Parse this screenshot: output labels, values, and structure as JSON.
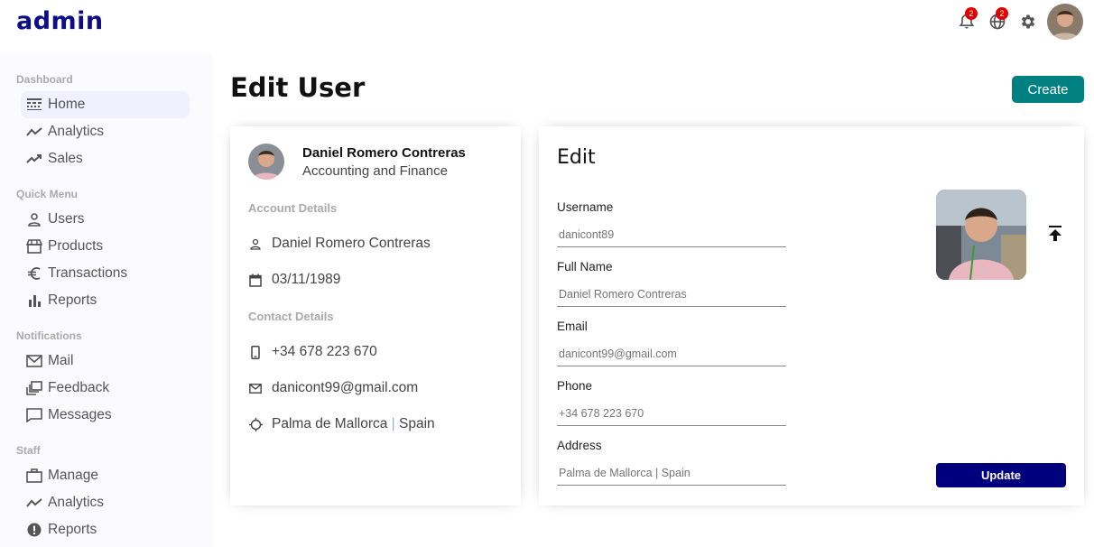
{
  "header": {
    "logo": "admin",
    "notifications_badge": "2",
    "language_badge": "2",
    "icons": [
      "bell-icon",
      "globe-icon",
      "gear-icon"
    ]
  },
  "sidebar": {
    "sections": [
      {
        "title": "Dashboard",
        "items": [
          {
            "label": "Home",
            "icon": "line-style-icon",
            "active": true
          },
          {
            "label": "Analytics",
            "icon": "timeline-icon"
          },
          {
            "label": "Sales",
            "icon": "trending-up-icon"
          }
        ]
      },
      {
        "title": "Quick Menu",
        "items": [
          {
            "label": "Users",
            "icon": "person-outline-icon"
          },
          {
            "label": "Products",
            "icon": "storefront-icon"
          },
          {
            "label": "Transactions",
            "icon": "euro-icon"
          },
          {
            "label": "Reports",
            "icon": "bar-chart-icon"
          }
        ]
      },
      {
        "title": "Notifications",
        "items": [
          {
            "label": "Mail",
            "icon": "mail-outline-icon"
          },
          {
            "label": "Feedback",
            "icon": "dynamic-feed-icon"
          },
          {
            "label": "Messages",
            "icon": "chat-bubble-icon"
          }
        ]
      },
      {
        "title": "Staff",
        "items": [
          {
            "label": "Manage",
            "icon": "work-outline-icon"
          },
          {
            "label": "Analytics",
            "icon": "timeline-icon"
          },
          {
            "label": "Reports",
            "icon": "report-icon"
          }
        ]
      }
    ]
  },
  "main": {
    "title": "Edit User",
    "create_label": "Create"
  },
  "show": {
    "name": "Daniel Romero Contreras",
    "job": "Accounting and Finance",
    "account_title": "Account Details",
    "username": "Daniel Romero Contreras",
    "birthday": "03/11/1989",
    "contact_title": "Contact Details",
    "phone": "+34 678 223 670",
    "email": "danicont99@gmail.com",
    "city": "Palma de Mallorca",
    "separator": "|",
    "country": "Spain"
  },
  "edit": {
    "title": "Edit",
    "fields": [
      {
        "label": "Username",
        "placeholder": "danicont89"
      },
      {
        "label": "Full Name",
        "placeholder": "Daniel Romero Contreras"
      },
      {
        "label": "Email",
        "placeholder": "danicont99@gmail.com"
      },
      {
        "label": "Phone",
        "placeholder": "+34 678 223 670"
      },
      {
        "label": "Address",
        "placeholder": "Palma de Mallorca | Spain"
      }
    ],
    "update_label": "Update"
  }
}
